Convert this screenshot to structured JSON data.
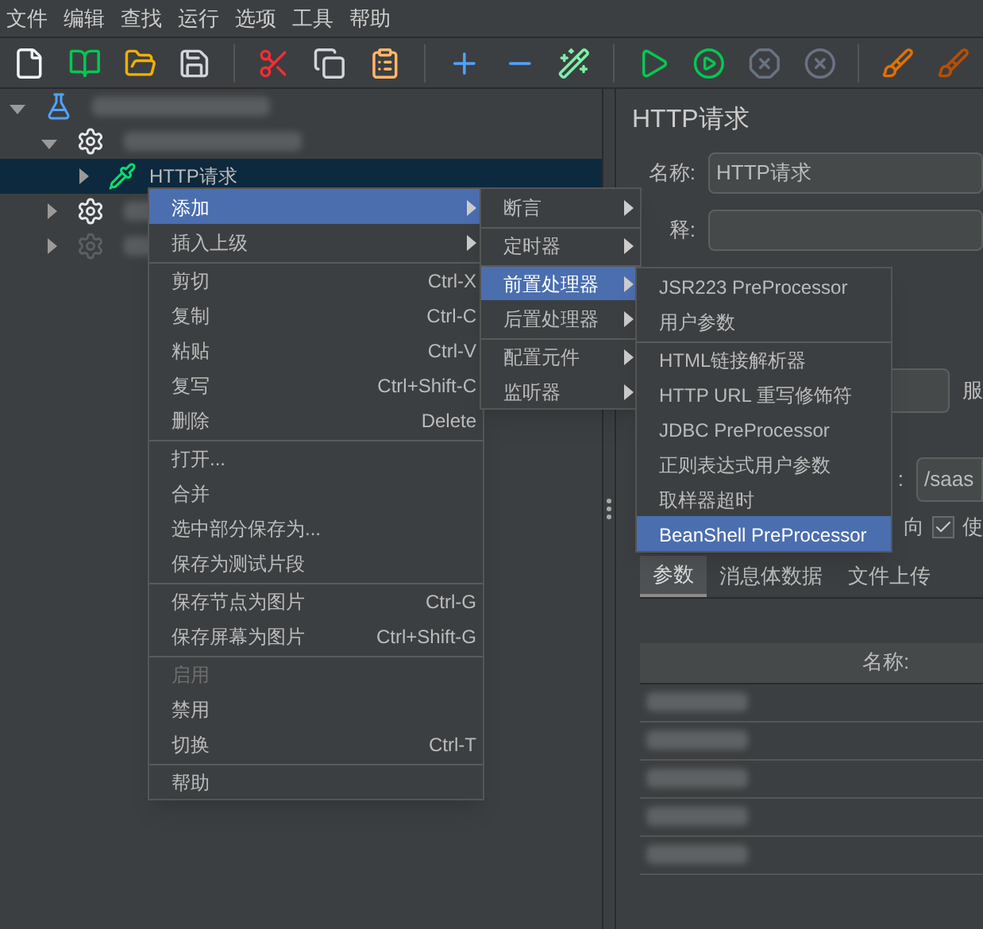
{
  "menubar": [
    "文件",
    "编辑",
    "查找",
    "运行",
    "选项",
    "工具",
    "帮助"
  ],
  "tree": [
    {
      "kind": "test-plan",
      "expanded": true,
      "selected": false,
      "disabled": false,
      "redacted": true,
      "children": [
        {
          "kind": "thread-group",
          "expanded": true,
          "selected": false,
          "disabled": false,
          "redacted": true,
          "children": [
            {
              "kind": "sampler",
              "label": "HTTP请求",
              "expanded": false,
              "selected": true,
              "disabled": false,
              "redacted": false
            }
          ]
        },
        {
          "kind": "thread-group",
          "expanded": false,
          "selected": false,
          "disabled": false,
          "redacted": true
        },
        {
          "kind": "thread-group",
          "expanded": false,
          "selected": false,
          "disabled": true,
          "redacted": true
        }
      ]
    }
  ],
  "panel": {
    "title": "HTTP请求",
    "name_label": "名称:",
    "name_value": "HTTP请求",
    "comment_label": "释:",
    "server_label": "服",
    "path_label": ":",
    "path_value": "/saas",
    "option_text": "向",
    "option_checked": true,
    "option_label": "使",
    "tabs": [
      {
        "label": "参数",
        "selected": true
      },
      {
        "label": "消息体数据",
        "selected": false
      },
      {
        "label": "文件上传",
        "selected": false
      }
    ],
    "table": {
      "column": "名称:",
      "rows": [
        {
          "kind": "blurred"
        },
        {
          "kind": "blurred"
        },
        {
          "kind": "blurred"
        },
        {
          "kind": "blurred"
        },
        {
          "kind": "blurred"
        }
      ]
    }
  },
  "context_menu": [
    {
      "label": "添加",
      "submenu": true,
      "selected": true,
      "disabled": false,
      "separator_before": false
    },
    {
      "label": "插入上级",
      "submenu": true,
      "selected": false,
      "disabled": false,
      "separator_before": false
    },
    {
      "label": "剪切",
      "shortcut": "Ctrl-X",
      "selected": false,
      "disabled": false,
      "separator_before": true
    },
    {
      "label": "复制",
      "shortcut": "Ctrl-C",
      "selected": false,
      "disabled": false,
      "separator_before": false
    },
    {
      "label": "粘贴",
      "shortcut": "Ctrl-V",
      "selected": false,
      "disabled": false,
      "separator_before": false
    },
    {
      "label": "复写",
      "shortcut": "Ctrl+Shift-C",
      "selected": false,
      "disabled": false,
      "separator_before": false
    },
    {
      "label": "删除",
      "shortcut": "Delete",
      "selected": false,
      "disabled": false,
      "separator_before": false
    },
    {
      "label": "打开...",
      "selected": false,
      "disabled": false,
      "separator_before": true
    },
    {
      "label": "合并",
      "selected": false,
      "disabled": false,
      "separator_before": false
    },
    {
      "label": "选中部分保存为...",
      "selected": false,
      "disabled": false,
      "separator_before": false
    },
    {
      "label": "保存为测试片段",
      "selected": false,
      "disabled": false,
      "separator_before": false
    },
    {
      "label": "保存节点为图片",
      "shortcut": "Ctrl-G",
      "selected": false,
      "disabled": false,
      "separator_before": true
    },
    {
      "label": "保存屏幕为图片",
      "shortcut": "Ctrl+Shift-G",
      "selected": false,
      "disabled": false,
      "separator_before": false
    },
    {
      "label": "启用",
      "selected": false,
      "disabled": true,
      "separator_before": true
    },
    {
      "label": "禁用",
      "selected": false,
      "disabled": false,
      "separator_before": false
    },
    {
      "label": "切换",
      "shortcut": "Ctrl-T",
      "selected": false,
      "disabled": false,
      "separator_before": false
    },
    {
      "label": "帮助",
      "selected": false,
      "disabled": false,
      "separator_before": true
    }
  ],
  "submenu": [
    {
      "label": "断言",
      "submenu": true,
      "selected": false,
      "separator_before": false
    },
    {
      "label": "定时器",
      "submenu": true,
      "selected": false,
      "separator_before": true
    },
    {
      "label": "前置处理器",
      "submenu": true,
      "selected": true,
      "separator_before": true
    },
    {
      "label": "后置处理器",
      "submenu": true,
      "selected": false,
      "separator_before": false
    },
    {
      "label": "配置元件",
      "submenu": true,
      "selected": false,
      "separator_before": true
    },
    {
      "label": "监听器",
      "submenu": true,
      "selected": false,
      "separator_before": false
    }
  ],
  "submenu2": [
    {
      "label": "JSR223 PreProcessor",
      "selected": false,
      "separator_before": false
    },
    {
      "label": "用户参数",
      "selected": false,
      "separator_before": false
    },
    {
      "label": "HTML链接解析器",
      "selected": false,
      "separator_before": true
    },
    {
      "label": "HTTP URL 重写修饰符",
      "selected": false,
      "separator_before": false
    },
    {
      "label": "JDBC PreProcessor",
      "selected": false,
      "separator_before": false
    },
    {
      "label": "正则表达式用户参数",
      "selected": false,
      "separator_before": false
    },
    {
      "label": "取样器超时",
      "selected": false,
      "separator_before": false
    },
    {
      "label": "BeanShell PreProcessor",
      "selected": true,
      "separator_before": false
    }
  ]
}
